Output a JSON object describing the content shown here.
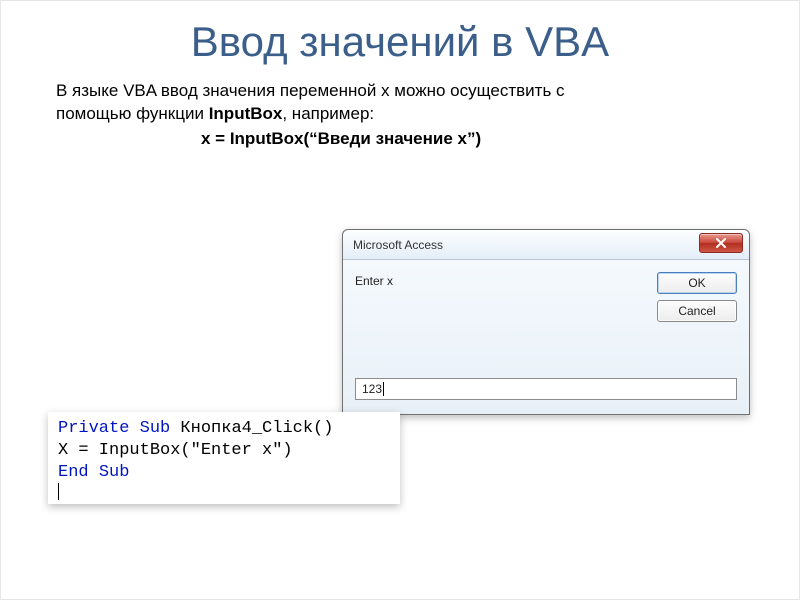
{
  "title": "Ввод значений в VBA",
  "intro": {
    "line1_a": "В языке VBA ввод значения переменной x можно осуществить с",
    "line2_a": "помощью функции ",
    "line2_strong": "InputBox",
    "line2_b": ", например:",
    "code_line": "x = InputBox(“Введи значение x”)"
  },
  "dialog": {
    "title": "Microsoft Access",
    "prompt": "Enter x",
    "ok_label": "OK",
    "cancel_label": "Cancel",
    "input_value": "123"
  },
  "code": {
    "kw_private": "Private ",
    "kw_sub": "Sub",
    "name": " Кнопка4_Click()",
    "body": "X = InputBox(\"Enter x\")",
    "kw_end": "End ",
    "kw_sub2": "Sub"
  }
}
